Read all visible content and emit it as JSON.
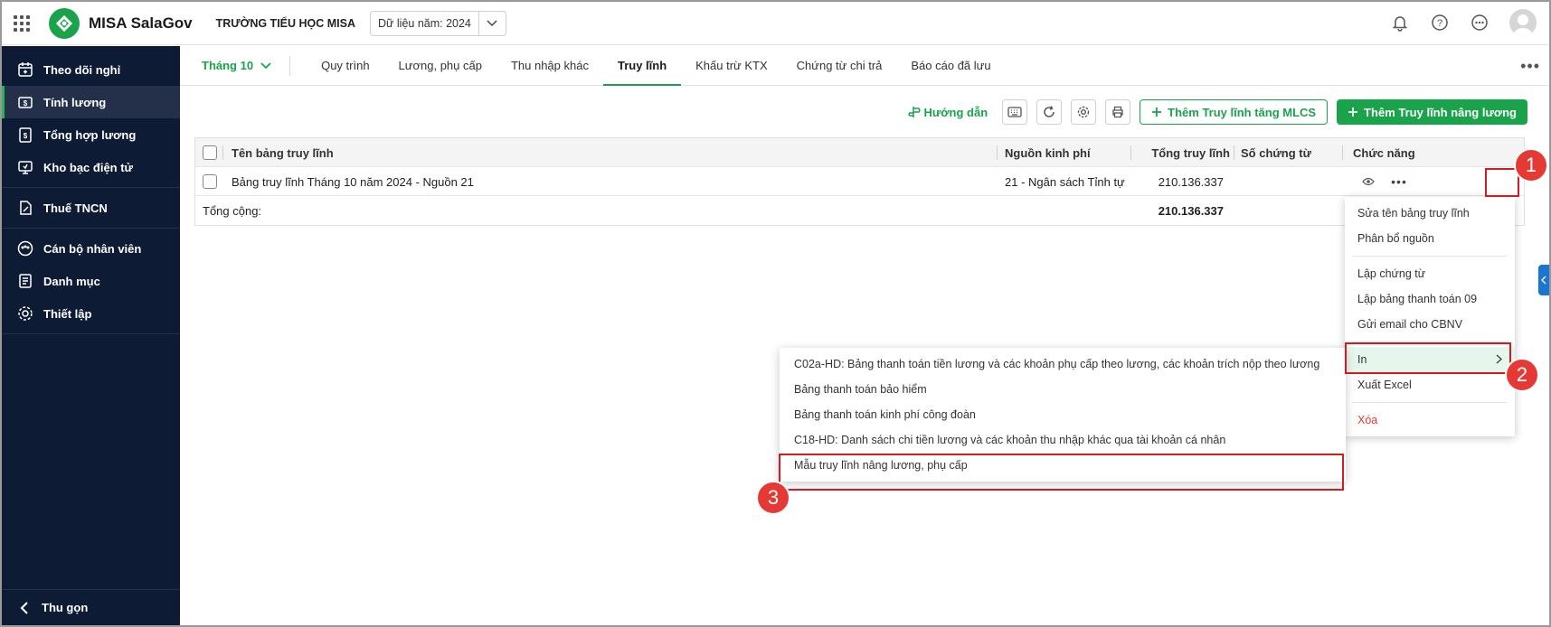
{
  "app": {
    "brand": "MISA SalaGov",
    "school": "TRƯỜNG TIỂU HỌC MISA",
    "year_label": "Dữ liệu năm: 2024"
  },
  "sidebar": {
    "items": [
      {
        "label": "Theo dõi nghỉ",
        "icon": "calendar-icon"
      },
      {
        "label": "Tính lương",
        "icon": "payroll-icon",
        "active": true
      },
      {
        "label": "Tổng hợp lương",
        "icon": "summary-icon"
      },
      {
        "label": "Kho bạc điện tử",
        "icon": "treasury-icon"
      },
      {
        "label": "Thuế TNCN",
        "icon": "tax-icon"
      },
      {
        "label": "Cán bộ nhân viên",
        "icon": "staff-icon"
      },
      {
        "label": "Danh mục",
        "icon": "catalog-icon"
      },
      {
        "label": "Thiết lập",
        "icon": "settings-icon"
      }
    ],
    "collapse_label": "Thu gọn"
  },
  "tabs": {
    "month": "Tháng 10",
    "items": [
      "Quy trình",
      "Lương, phụ cấp",
      "Thu nhập khác",
      "Truy lĩnh",
      "Khấu trừ KTX",
      "Chứng từ chi trả",
      "Báo cáo đã lưu"
    ],
    "active": "Truy lĩnh"
  },
  "toolbar": {
    "guide_label": "Hướng dẫn",
    "add_mlcs_label": "Thêm Truy lĩnh tăng MLCS",
    "add_raise_label": "Thêm Truy lĩnh nâng lương"
  },
  "table": {
    "headers": {
      "name": "Tên bảng truy lĩnh",
      "source": "Nguồn kinh phí",
      "total": "Tổng truy lĩnh",
      "voucher": "Số chứng từ",
      "action": "Chức năng"
    },
    "rows": [
      {
        "name": "Bảng truy lĩnh Tháng 10 năm 2024 - Nguồn 21",
        "source": "21 - Ngân sách Tỉnh tự ...",
        "total": "210.136.337",
        "voucher": ""
      }
    ],
    "footer": {
      "label": "Tổng cộng:",
      "total": "210.136.337"
    }
  },
  "context_menu": {
    "group1": [
      "Sửa tên bảng truy lĩnh",
      "Phân bổ nguồn"
    ],
    "group2": [
      "Lập chứng từ",
      "Lập bảng thanh toán 09",
      "Gửi email cho CBNV"
    ],
    "print": "In",
    "export": "Xuất Excel",
    "delete": "Xóa"
  },
  "print_submenu": [
    "C02a-HD: Bảng thanh toán tiền lương và các khoản phụ cấp theo lương, các khoản trích nộp theo lương",
    "Bảng thanh toán bảo hiểm",
    "Bảng thanh toán kinh phí công đoàn",
    "C18-HD: Danh sách chi tiền lương và các khoản thu nhập khác qua tài khoản cá nhân",
    "Mẫu truy lĩnh nâng lương, phụ cấp"
  ],
  "annotations": {
    "step1": "1",
    "step2": "2",
    "step3": "3"
  },
  "colors": {
    "brand_green": "#1aa34a",
    "sidebar_bg": "#0e1b35",
    "highlight_red": "#d71a21"
  }
}
